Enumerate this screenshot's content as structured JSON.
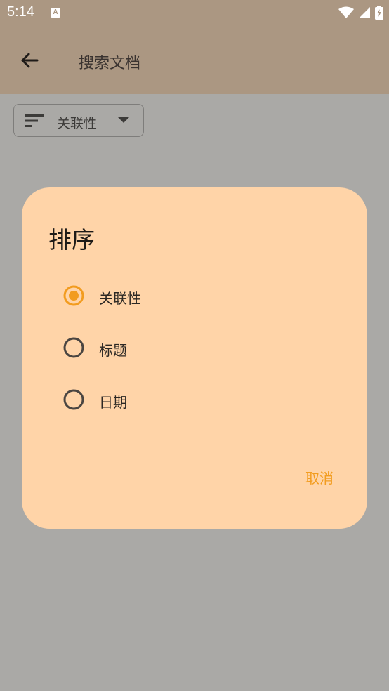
{
  "status": {
    "time": "5:14",
    "notification_icon": "A"
  },
  "appbar": {
    "title": "搜索文档"
  },
  "sort_chip": {
    "label": "关联性"
  },
  "dialog": {
    "title": "排序",
    "options": [
      {
        "label": "关联性",
        "selected": true
      },
      {
        "label": "标题",
        "selected": false
      },
      {
        "label": "日期",
        "selected": false
      }
    ],
    "cancel_label": "取消"
  },
  "colors": {
    "accent": "#f29c1f",
    "dialog_bg": "#ffd4a8",
    "appbar_bg": "#ab9782",
    "scrim_bg": "#aaa9a6"
  }
}
